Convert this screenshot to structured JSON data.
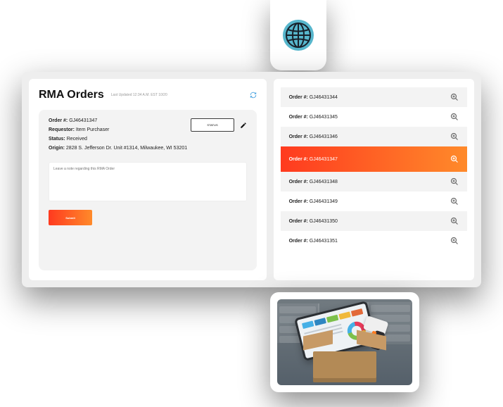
{
  "header": {
    "title": "RMA Orders",
    "last_updated": "Last Updated 12:34 A.M. EST 10/20"
  },
  "detail": {
    "order_label": "Order #:",
    "order_value": "GJ46431347",
    "requestor_label": "Requestor:",
    "requestor_value": "Item Purchaser",
    "status_label": "Status:",
    "status_value": "Received",
    "origin_label": "Origin:",
    "origin_value": "2828 S. Jefferson Dr. Unit #1314, Milwaukee, WI 53201",
    "status_button": "STATUS",
    "note_placeholder": "Leave a note regarding this RMA Order",
    "submit_label": "Submit"
  },
  "orders": {
    "label": "Order #:",
    "items": [
      {
        "id": "GJ46431344",
        "active": false
      },
      {
        "id": "GJ46431345",
        "active": false
      },
      {
        "id": "GJ46431346",
        "active": false
      },
      {
        "id": "GJ46431347",
        "active": true
      },
      {
        "id": "GJ46431348",
        "active": false
      },
      {
        "id": "GJ46431349",
        "active": false
      },
      {
        "id": "GJ46431350",
        "active": false
      },
      {
        "id": "GJ46431351",
        "active": false
      }
    ]
  },
  "colors": {
    "accent_start": "#ff3a1f",
    "accent_end": "#ff8a2a",
    "globe": "#57b6cc"
  }
}
